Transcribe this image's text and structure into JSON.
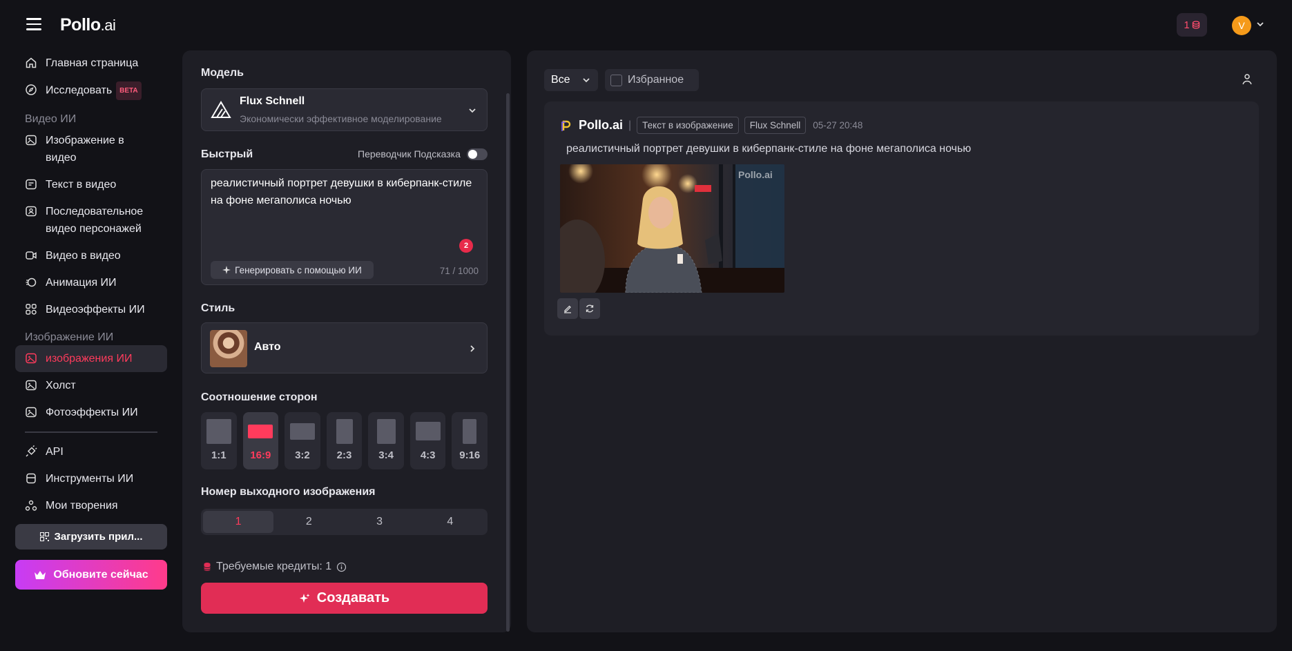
{
  "brand": {
    "name": "Pollo",
    "suffix": ".ai"
  },
  "header": {
    "credits": "1",
    "avatar_initial": "V"
  },
  "sidebar": {
    "items_top": [
      {
        "label": "Главная страница",
        "icon": "home-icon"
      },
      {
        "label": "Исследовать",
        "icon": "compass-icon",
        "badge": "BETA"
      }
    ],
    "section_video": "Видео ИИ",
    "items_video": [
      {
        "label": "Изображение в видео",
        "icon": "image-video-icon"
      },
      {
        "label": "Текст в видео",
        "icon": "text-video-icon"
      },
      {
        "label": "Последовательное видео персонажей",
        "icon": "character-video-icon"
      },
      {
        "label": "Видео в видео",
        "icon": "video-video-icon"
      },
      {
        "label": "Анимация ИИ",
        "icon": "animation-icon"
      },
      {
        "label": "Видеоэффекты ИИ",
        "icon": "effects-icon"
      }
    ],
    "section_image": "Изображение ИИ",
    "items_image": [
      {
        "label": "изображения ИИ",
        "icon": "ai-image-icon",
        "active": true
      },
      {
        "label": "Холст",
        "icon": "canvas-icon"
      },
      {
        "label": "Фотоэффекты ИИ",
        "icon": "photo-effects-icon"
      }
    ],
    "items_bottom": [
      {
        "label": "API",
        "icon": "api-icon"
      },
      {
        "label": "Инструменты ИИ",
        "icon": "tools-icon"
      },
      {
        "label": "Мои творения",
        "icon": "creations-icon"
      }
    ],
    "download_label": "Загрузить прил...",
    "upgrade_label": "Обновите сейчас"
  },
  "form": {
    "model_label": "Модель",
    "model_name": "Flux Schnell",
    "model_desc": "Экономически эффективное моделирование",
    "prompt_label": "Быстрый",
    "translator_label": "Переводчик Подсказка",
    "prompt_text": "реалистичный портрет девушки в киберпанк-стиле на фоне мегаполиса ночью",
    "generate_ai_label": "Генерировать с помощью ИИ",
    "char_count": "71 / 1000",
    "grammar_badge": "2",
    "style_label": "Стиль",
    "style_name": "Авто",
    "ratio_label": "Соотношение сторон",
    "ratios": [
      {
        "label": "1:1",
        "active": false
      },
      {
        "label": "16:9",
        "active": true
      },
      {
        "label": "3:2",
        "active": false
      },
      {
        "label": "2:3",
        "active": false
      },
      {
        "label": "3:4",
        "active": false
      },
      {
        "label": "4:3",
        "active": false
      },
      {
        "label": "9:16",
        "active": false
      }
    ],
    "output_count_label": "Номер выходного изображения",
    "output_counts": [
      "1",
      "2",
      "3",
      "4"
    ],
    "output_count_selected": "1",
    "credits_text": "Требуемые кредиты: 1",
    "create_label": "Создавать"
  },
  "results": {
    "filter_value": "Все",
    "favorites_label": "Избранное",
    "card": {
      "brand": "Pollo.ai",
      "tag_type": "Текст в изображение",
      "tag_model": "Flux Schnell",
      "timestamp": "05-27 20:48",
      "prompt": "реалистичный портрет девушки в киберпанк-стиле на фоне мегаполиса ночью",
      "watermark": "Pollo.ai"
    }
  },
  "colors": {
    "accent": "#ff3b5c",
    "bg": "#121217",
    "panel": "#1e1e25"
  }
}
